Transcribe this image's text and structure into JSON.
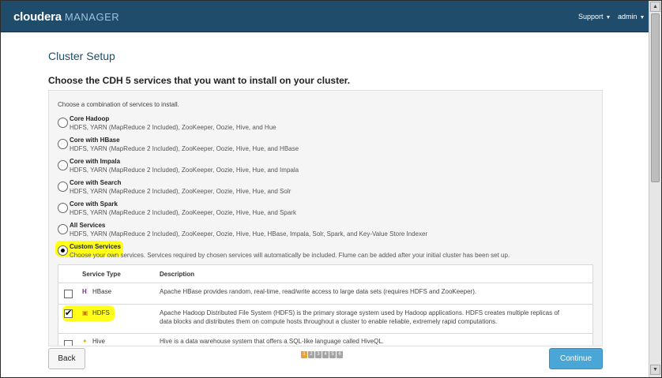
{
  "header": {
    "logo_brand": "cloudera",
    "logo_product": "MANAGER",
    "support_label": "Support",
    "admin_label": "admin"
  },
  "page": {
    "title": "Cluster Setup",
    "heading": "Choose the CDH 5 services that you want to install on your cluster."
  },
  "panel": {
    "intro": "Choose a combination of services to install.",
    "options": [
      {
        "label": "Core Hadoop",
        "desc": "HDFS, YARN (MapReduce 2 Included), ZooKeeper, Oozie, Hive, and Hue",
        "checked": false
      },
      {
        "label": "Core with HBase",
        "desc": "HDFS, YARN (MapReduce 2 Included), ZooKeeper, Oozie, Hive, Hue, and HBase",
        "checked": false
      },
      {
        "label": "Core with Impala",
        "desc": "HDFS, YARN (MapReduce 2 Included), ZooKeeper, Oozie, Hive, Hue, and Impala",
        "checked": false
      },
      {
        "label": "Core with Search",
        "desc": "HDFS, YARN (MapReduce 2 Included), ZooKeeper, Oozie, Hive, Hue, and Solr",
        "checked": false
      },
      {
        "label": "Core with Spark",
        "desc": "HDFS, YARN (MapReduce 2 Included), ZooKeeper, Oozie, Hive, Hue, and Spark",
        "checked": false
      },
      {
        "label": "All Services",
        "desc": "HDFS, YARN (MapReduce 2 Included), ZooKeeper, Oozie, Hive, Hue, HBase, Impala, Solr, Spark, and Key-Value Store Indexer",
        "checked": false
      },
      {
        "label": "Custom Services",
        "desc": "Choose your own services. Services required by chosen services will automatically be included. Flume can be added after your initial cluster has been set up.",
        "checked": true
      }
    ]
  },
  "services_table": {
    "col_type": "Service Type",
    "col_desc": "Description",
    "rows": [
      {
        "name": "HBase",
        "icon": "hbase-icon",
        "desc1": "Apache HBase provides random, real-time, read/write access to large data sets (requires HDFS and ZooKeeper).",
        "desc2": "",
        "checked": false
      },
      {
        "name": "HDFS",
        "icon": "hdfs-icon",
        "desc1": "Apache Hadoop Distributed File System (HDFS) is the primary storage system used by Hadoop applications. HDFS creates multiple replicas of",
        "desc2": "data blocks and distributes them on compute hosts throughout a cluster to enable reliable, extremely rapid computations.",
        "checked": true
      },
      {
        "name": "Hive",
        "icon": "hive-icon",
        "desc1": "Hive is a data warehouse system that offers a SQL-like language called HiveQL.",
        "desc2": "",
        "checked": false
      }
    ]
  },
  "footer": {
    "back_label": "Back",
    "continue_label": "Continue",
    "steps": [
      "1",
      "2",
      "3",
      "4",
      "5",
      "6"
    ],
    "current_step": "1"
  },
  "colors": {
    "header_bg": "#1f4c6a",
    "accent_button": "#4aa6d6",
    "highlight": "#ffff1a",
    "active_step": "#e9a23a"
  }
}
